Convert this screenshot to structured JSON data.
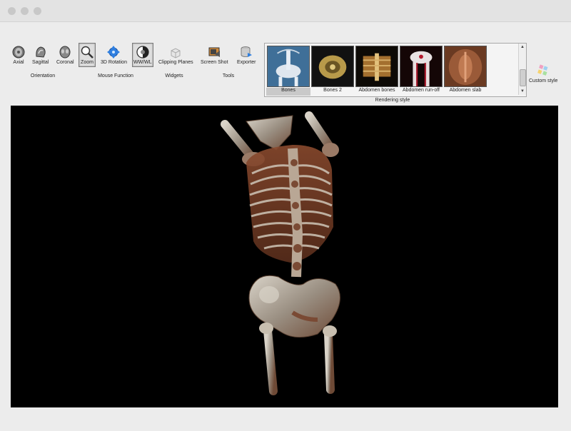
{
  "toolbar": {
    "orientation": {
      "group_label": "Orientation",
      "axial": "Axial",
      "sagittal": "Sagittal",
      "coronal": "Coronal"
    },
    "mouse_function": {
      "group_label": "Mouse Function",
      "zoom": "Zoom",
      "rotation": "3D Rotation",
      "wwwl": "WW/WL"
    },
    "widgets": {
      "group_label": "Widgets",
      "clipping_planes": "Clipping Planes"
    },
    "tools": {
      "group_label": "Tools",
      "screen_shot": "Screen Shot",
      "exporter": "Exporter"
    }
  },
  "rendering_style": {
    "group_label": "Rendering style",
    "presets": [
      "Bones",
      "Bones 2",
      "Abdomen bones",
      "Abdomen run-off",
      "Abdomen slab"
    ],
    "selected": "Bones",
    "custom_label": "Custom style"
  },
  "icons": [
    "axial-icon",
    "sagittal-icon",
    "coronal-icon",
    "zoom-icon",
    "3d-rotation-icon",
    "wwwl-icon",
    "clipping-planes-icon",
    "screen-shot-icon",
    "exporter-icon",
    "custom-style-icon"
  ],
  "colors": {
    "viewer_background": "#000000",
    "window_background": "#ececec"
  }
}
